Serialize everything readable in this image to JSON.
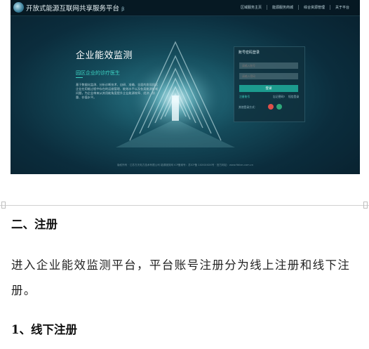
{
  "screenshot": {
    "header": {
      "title": "开放式能源互联网共享服务平台",
      "beta": "β",
      "nav": [
        "区域服务主页",
        "能源服务商城",
        "综合资源管理",
        "关于平台"
      ]
    },
    "hero": {
      "title": "企业能效监测",
      "subtitle": "园区企业的诊疗医生",
      "description": "基于数据化监测、分析诊断技术、自研、准确、全面的发现园区企业在用能过程中存在的运维管理、能效水平以及各类能源能耗问题，为企业带来从其用能角度提升企业能源效率、经济、质量、价值水平。"
    },
    "login": {
      "title": "账号密码登录",
      "username_placeholder": "请输入账号",
      "password_placeholder": "请输入密码",
      "submit": "登录",
      "register": "注册账号",
      "forgot": "忘记密码?",
      "sms_login": "短信登录",
      "third_party": "其他登录方式："
    },
    "footer": "版权所有 · 江苏方天电力技术有限公司 能源服务网  ICP备案号：苏ICP备 1XXXXXXX号 · 官方网站：www.ftdian.com.cn"
  },
  "document": {
    "section_heading": "二、注册",
    "paragraph": "进入企业能效监测平台，平台账号注册分为线上注册和线下注册。",
    "subsection_heading": "1、线下注册"
  },
  "colors": {
    "accent_teal": "#1c9b8e",
    "subtitle_teal": "#3ed6c5",
    "background_dark": "#0b2d3d",
    "qr_red": "#e0504a",
    "qr_green": "#2ea77a"
  }
}
